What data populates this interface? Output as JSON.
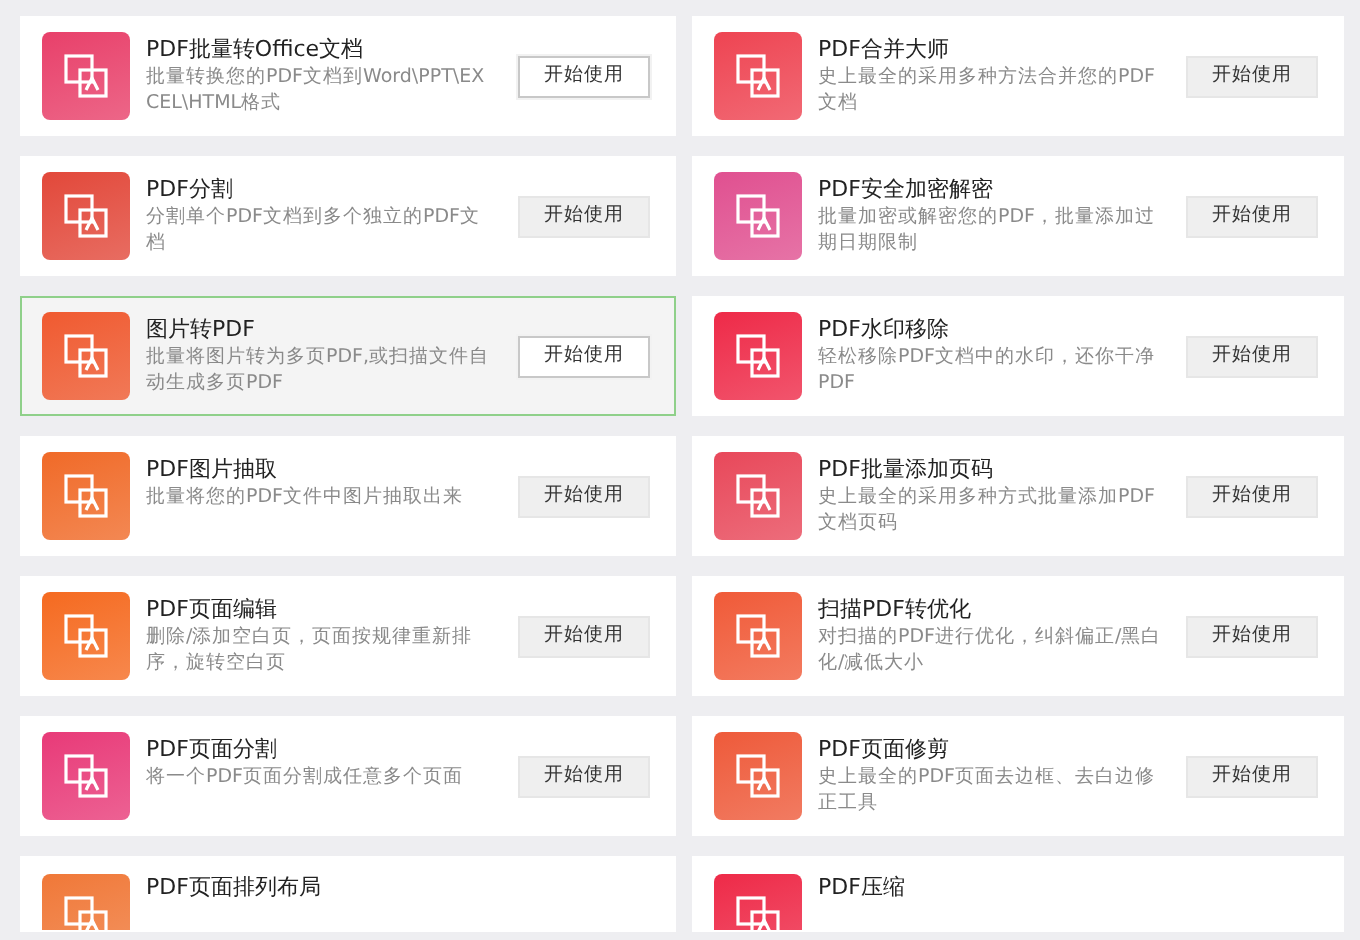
{
  "tools": [
    {
      "title": "PDF批量转Office文档",
      "description": "批量转换您的PDF文档到Word\\PPT\\EXCEL\\HTML格式",
      "button": "开始使用",
      "button_hovered": true,
      "selected": false,
      "color": "#e8406a"
    },
    {
      "title": "PDF合并大师",
      "description": "史上最全的采用多种方法合并您的PDF文档",
      "button": "开始使用",
      "button_hovered": false,
      "selected": false,
      "color": "#ee4452"
    },
    {
      "title": "PDF分割",
      "description": "分割单个PDF文档到多个独立的PDF文档",
      "button": "开始使用",
      "button_hovered": false,
      "selected": false,
      "color": "#e2483a"
    },
    {
      "title": "PDF安全加密解密",
      "description": "批量加密或解密您的PDF，批量添加过期日期限制",
      "button": "开始使用",
      "button_hovered": false,
      "selected": false,
      "color": "#e05090"
    },
    {
      "title": "图片转PDF",
      "description": "批量将图片转为多页PDF,或扫描文件自动生成多页PDF",
      "button": "开始使用",
      "button_hovered": true,
      "selected": true,
      "color": "#f05a30"
    },
    {
      "title": "PDF水印移除",
      "description": "轻松移除PDF文档中的水印，还你干净PDF",
      "button": "开始使用",
      "button_hovered": false,
      "selected": false,
      "color": "#ee2a48"
    },
    {
      "title": "PDF图片抽取",
      "description": "批量将您的PDF文件中图片抽取出来",
      "button": "开始使用",
      "button_hovered": false,
      "selected": false,
      "color": "#f06a28"
    },
    {
      "title": "PDF批量添加页码",
      "description": "史上最全的采用多种方式批量添加PDF文档页码",
      "button": "开始使用",
      "button_hovered": false,
      "selected": false,
      "color": "#e8485a"
    },
    {
      "title": "PDF页面编辑",
      "description": "删除/添加空白页，页面按规律重新排序，旋转空白页",
      "button": "开始使用",
      "button_hovered": false,
      "selected": false,
      "color": "#f56a20"
    },
    {
      "title": "扫描PDF转优化",
      "description": "对扫描的PDF进行优化，纠斜偏正/黑白化/减低大小",
      "button": "开始使用",
      "button_hovered": false,
      "selected": false,
      "color": "#f05a38"
    },
    {
      "title": "PDF页面分割",
      "description": "将一个PDF页面分割成任意多个页面",
      "button": "开始使用",
      "button_hovered": false,
      "selected": false,
      "color": "#e83a78"
    },
    {
      "title": "PDF页面修剪",
      "description": "史上最全的PDF页面去边框、去白边修正工具",
      "button": "开始使用",
      "button_hovered": false,
      "selected": false,
      "color": "#ee5a3a"
    },
    {
      "title": "PDF页面排列布局",
      "selected": false,
      "color": "#f07838"
    },
    {
      "title": "PDF压缩",
      "selected": false,
      "color": "#ee2a48"
    }
  ]
}
